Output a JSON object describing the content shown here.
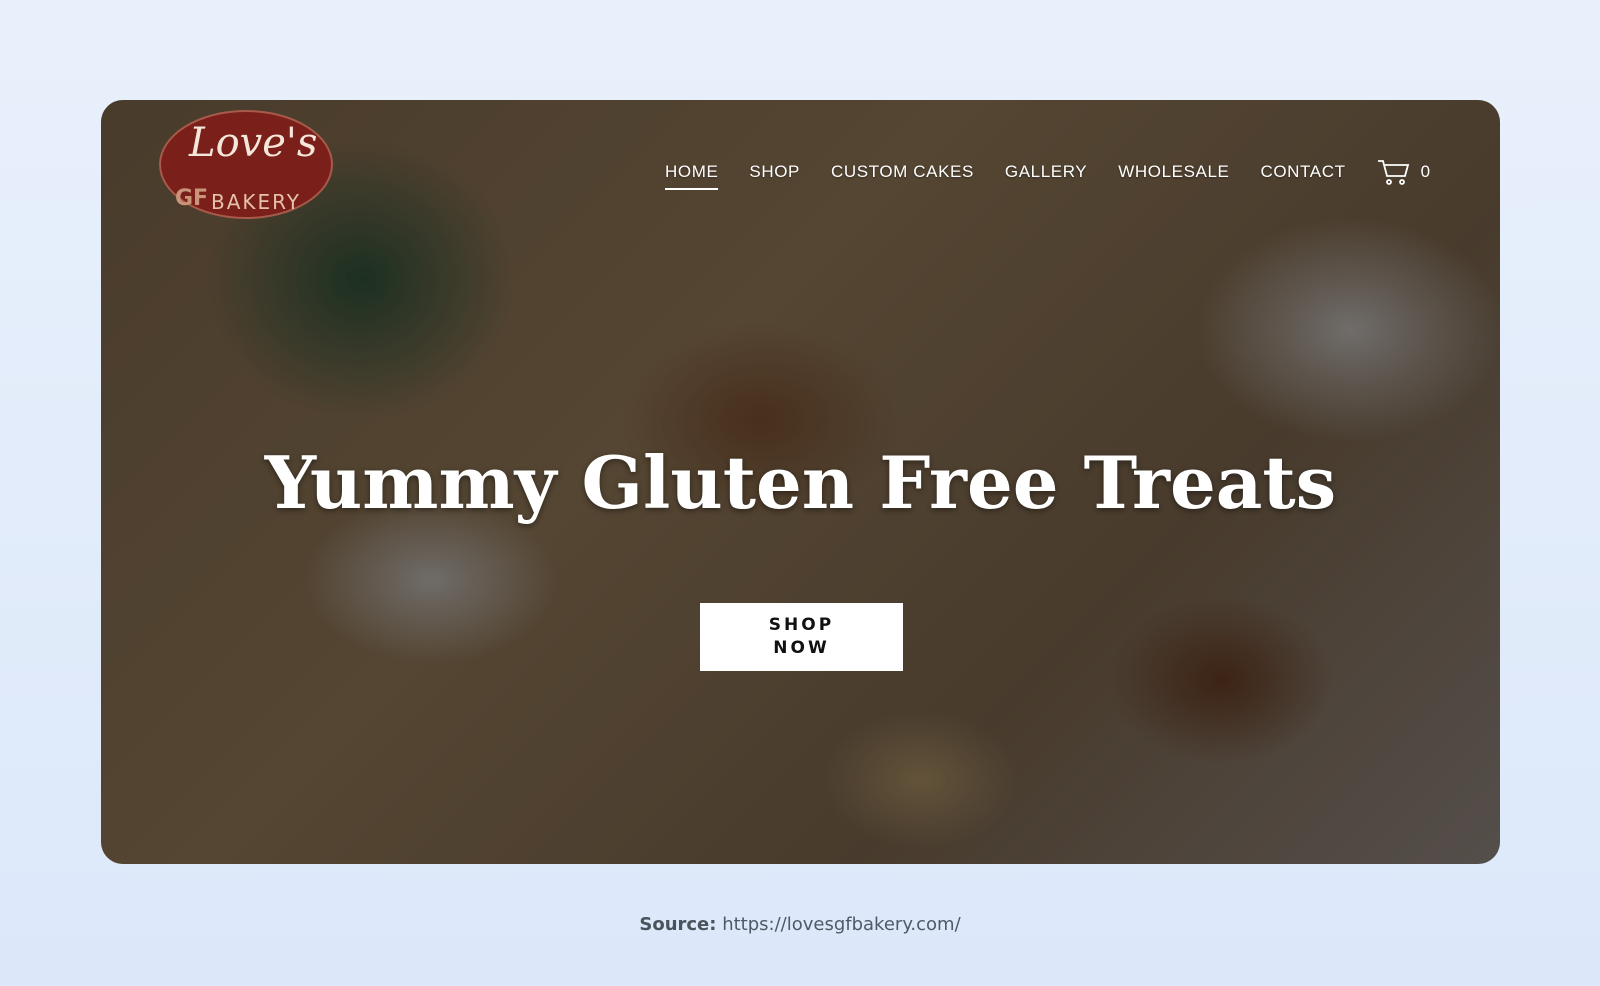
{
  "logo": {
    "script": "Love's",
    "mark": "GF",
    "word": "BAKERY"
  },
  "nav": {
    "items": [
      {
        "label": "HOME",
        "active": true
      },
      {
        "label": "SHOP"
      },
      {
        "label": "CUSTOM CAKES"
      },
      {
        "label": "GALLERY"
      },
      {
        "label": "WHOLESALE"
      },
      {
        "label": "CONTACT"
      }
    ],
    "cart_icon": "shopping-cart-icon",
    "cart_count": "0"
  },
  "hero": {
    "title": "Yummy Gluten Free Treats",
    "cta_line1": "SHOP",
    "cta_line2": "NOW"
  },
  "caption": {
    "label": "Source:",
    "url": "https://lovesgfbakery.com/"
  }
}
